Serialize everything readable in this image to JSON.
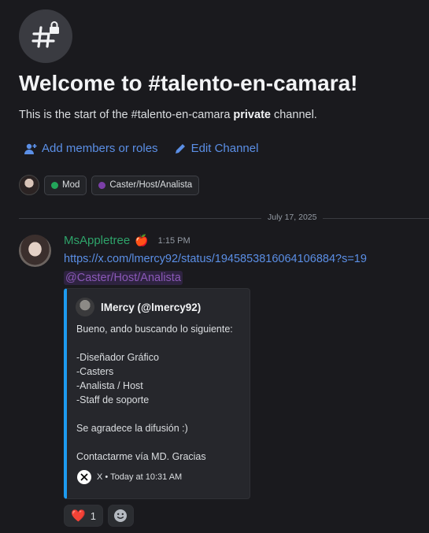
{
  "header": {
    "channel_icon": "hash-lock-icon",
    "title": "Welcome to #talento-en-camara!",
    "subtitle_pre": "This is the start of the #talento-en-camara ",
    "subtitle_bold": "private",
    "subtitle_post": " channel."
  },
  "actions": {
    "add_members": "Add members or roles",
    "edit_channel": "Edit Channel"
  },
  "roles": [
    {
      "label": "Mod",
      "color": "#23a55a"
    },
    {
      "label": "Caster/Host/Analista",
      "color": "#7b3fa8"
    }
  ],
  "divider": {
    "date": "July 17, 2025"
  },
  "message": {
    "username": "MsAppletree",
    "username_color": "#2ea36a",
    "badge_emoji": "🍎",
    "timestamp": "1:15 PM",
    "link": "https://x.com/lmercy92/status/1945853816064106884?s=19",
    "mention": "@Caster/Host/Analista"
  },
  "embed": {
    "accent_color": "#1d9bf0",
    "author": "lMercy (@lmercy92)",
    "description": [
      "Bueno, ando buscando lo siguiente:",
      "",
      "-Diseñador Gráfico",
      "-Casters",
      "-Analista / Host",
      "-Staff de soporte",
      "",
      "Se agradece la difusión :)",
      "",
      "Contactarme vía MD. Gracias"
    ],
    "footer": "X • Today at 10:31 AM"
  },
  "reactions": [
    {
      "emoji": "❤️",
      "count": "1"
    }
  ]
}
